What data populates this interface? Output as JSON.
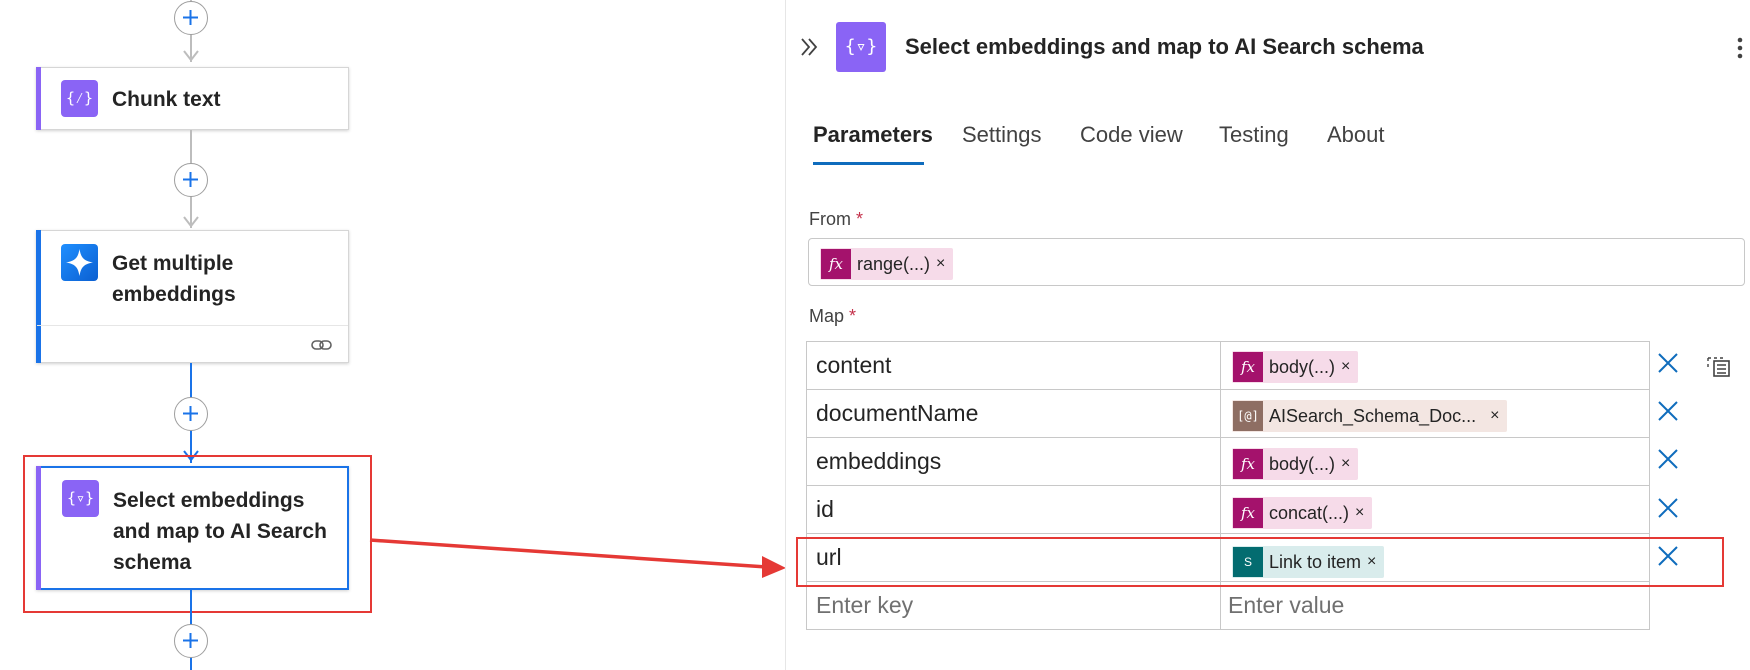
{
  "flow": {
    "cards": [
      {
        "title": "Chunk text",
        "icon": "data-operation-icon"
      },
      {
        "title_line1": "Get multiple",
        "title_line2": "embeddings",
        "icon": "ai-sparkle-icon",
        "footer_icon": "link-icon"
      },
      {
        "title_line1": "Select embeddings",
        "title_line2": "and map to AI Search",
        "title_line3": "schema",
        "icon": "select-operation-icon"
      }
    ],
    "colors": {
      "connector_gray": "#bdbdbd",
      "connector_blue": "#1a73e8",
      "highlight_red": "#e53935",
      "operation_purple": "#8a64f5"
    }
  },
  "panel": {
    "title": "Select embeddings and map to AI Search schema",
    "tabs": [
      "Parameters",
      "Settings",
      "Code view",
      "Testing",
      "About"
    ],
    "active_tab": "Parameters",
    "from": {
      "label": "From",
      "required": "*",
      "token": {
        "icon": "fx",
        "text": "range(...)",
        "remove": "×"
      }
    },
    "map": {
      "label": "Map",
      "required": "*",
      "rows": [
        {
          "key": "content",
          "token_icon": "fx",
          "token_text": "body(...)",
          "token_type": "expression"
        },
        {
          "key": "documentName",
          "token_icon": "[@]",
          "token_text": "AISearch_Schema_Doc...",
          "token_type": "variable"
        },
        {
          "key": "embeddings",
          "token_icon": "fx",
          "token_text": "body(...)",
          "token_type": "expression"
        },
        {
          "key": "id",
          "token_icon": "fx",
          "token_text": "concat(...)",
          "token_type": "expression"
        },
        {
          "key": "url",
          "token_icon": "S",
          "token_text": "Link to item",
          "token_type": "sharepoint"
        }
      ],
      "remove": "×",
      "key_placeholder": "Enter key",
      "value_placeholder": "Enter value"
    }
  }
}
